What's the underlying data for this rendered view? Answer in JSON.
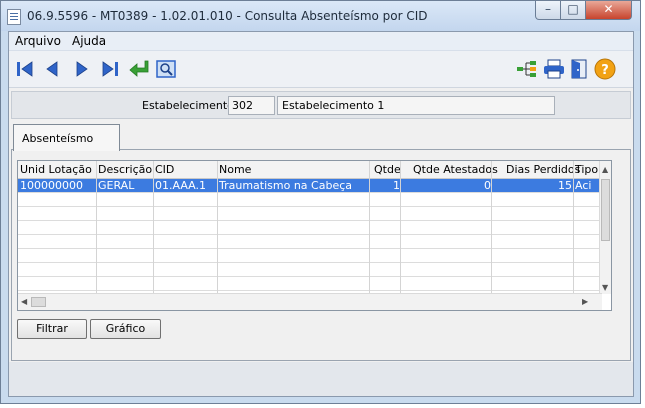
{
  "window": {
    "title": "06.9.5596 - MT0389 - 1.02.01.010 - Consulta Absenteísmo por CID"
  },
  "window_controls": {
    "minimize": "–",
    "maximize": "□",
    "close": "✕"
  },
  "menu": {
    "items": [
      "Arquivo",
      "Ajuda"
    ]
  },
  "toolbar": {
    "icons": [
      "first-record-icon",
      "previous-record-icon",
      "next-record-icon",
      "last-record-icon",
      "confirm-return-icon",
      "preview-icon",
      "tree-structure-icon",
      "print-icon",
      "exit-door-icon",
      "help-icon"
    ],
    "colors": {
      "nav_blue": "#2f64c8",
      "confirm_green": "#39a036",
      "help_orange": "#f2a214"
    }
  },
  "estabelecimento": {
    "label": "Estabelecimento:",
    "code": "302",
    "name": "Estabelecimento  1"
  },
  "tab": {
    "label": "Absenteísmo"
  },
  "grid": {
    "columns": [
      "Unid Lotação",
      "Descrição",
      "CID",
      "Nome",
      "Qtde",
      "Qtde Atestados",
      "Dias Perdidos",
      "Tipo"
    ],
    "rows": [
      [
        "100000000",
        "GERAL",
        "01.AAA.1",
        "Traumatismo na Cabeça",
        "1",
        "0",
        "15",
        "Aci"
      ]
    ],
    "selected_color": "#3c7be0"
  },
  "buttons": {
    "filtrar": "Filtrar",
    "grafico": "Gráfico"
  }
}
